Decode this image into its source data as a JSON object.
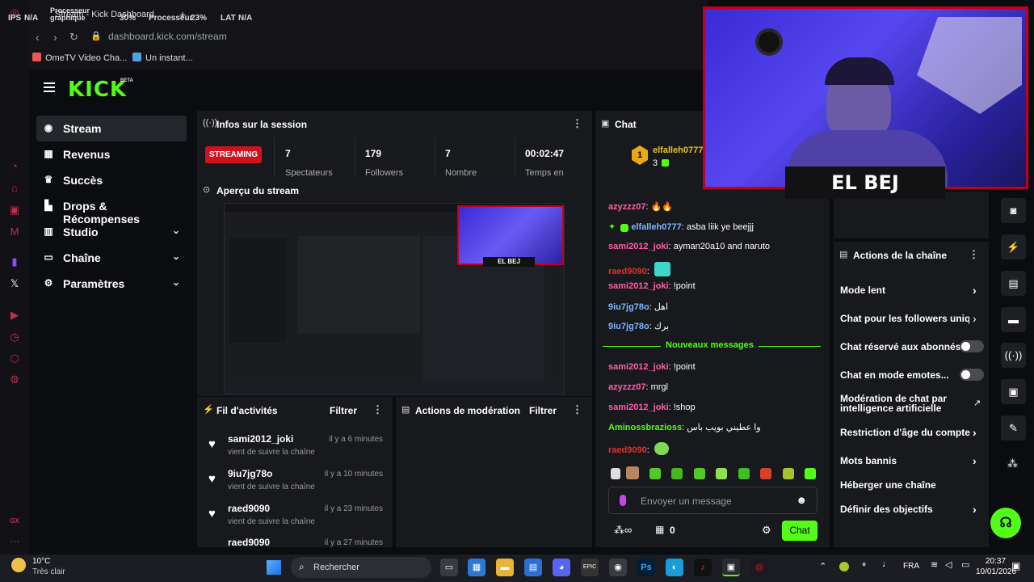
{
  "browser": {
    "tab_title": "Stream - Kick Dashboard",
    "perf": {
      "ips_label": "IPS",
      "ips_value": "N/A",
      "gpu_label": "Processeur graphique",
      "gpu_value": "30%",
      "cpu_label": "Processeur",
      "cpu_value": "23%",
      "lat_label": "LAT",
      "lat_value": "N/A"
    },
    "url": "dashboard.kick.com/stream",
    "bookmarks": [
      "OmeTV Video Cha...",
      "Un instant..."
    ],
    "opera_bottom_label": "GX"
  },
  "brand": {
    "logo": "KICK",
    "badge": "BETA",
    "accent": "#53fc18"
  },
  "sidebar": {
    "items": [
      {
        "label": "Stream",
        "icon": "broadcast-icon"
      },
      {
        "label": "Revenus",
        "icon": "chart-icon"
      },
      {
        "label": "Succès",
        "icon": "trophy-icon"
      },
      {
        "label": "Drops & Récompenses",
        "icon": "gift-icon"
      },
      {
        "label": "Studio",
        "icon": "studio-icon"
      },
      {
        "label": "Chaîne",
        "icon": "channel-icon"
      },
      {
        "label": "Paramètres",
        "icon": "gear-icon"
      }
    ]
  },
  "session": {
    "title": "Infos sur la session",
    "status": "STREAMING",
    "stats": [
      {
        "value": "7",
        "label": "Spectateurs"
      },
      {
        "value": "179",
        "label": "Followers"
      },
      {
        "value": "7",
        "label": "Nombre"
      },
      {
        "value": "00:02:47",
        "label": "Temps en"
      }
    ]
  },
  "preview": {
    "title": "Aperçu du stream",
    "overlay_name": "EL BEJ"
  },
  "activity": {
    "title": "Fil d'activités",
    "filter_label": "Filtrer",
    "items": [
      {
        "user": "sami2012_joki",
        "time": "il y a 6 minutes",
        "sub": "vient de suivre la chaîne"
      },
      {
        "user": "9iu7jg78o",
        "time": "il y a 10 minutes",
        "sub": "vient de suivre la chaîne"
      },
      {
        "user": "raed9090",
        "time": "il y a 23 minutes",
        "sub": "vient de suivre la chaîne"
      },
      {
        "user": "raed9090",
        "time": "il y a 27 minutes",
        "sub": ""
      }
    ]
  },
  "moderation": {
    "title": "Actions de modération",
    "filter_label": "Filtrer"
  },
  "chat": {
    "title": "Chat",
    "pinned_user": "elfalleh0777",
    "pinned_rank": "1",
    "pinned_count": "3",
    "messages": [
      {
        "user": "azyzzz07",
        "text": "🔥🔥",
        "color": "#ff5fa8"
      },
      {
        "user": "elfalleh0777",
        "text": "asba liik ye beejjj",
        "color": "#7eb6ff"
      },
      {
        "user": "sami2012_joki",
        "text": "ayman20a10 and naruto",
        "color": "#ff5fa8"
      },
      {
        "user": "raed9090",
        "text": "",
        "color": "#e0302e"
      },
      {
        "user": "sami2012_joki",
        "text": "!point",
        "color": "#ff5fa8"
      },
      {
        "user": "9iu7jg78o",
        "text": "اهل",
        "color": "#7eb6ff"
      },
      {
        "user": "9iu7jg78o",
        "text": "برك",
        "color": "#7eb6ff"
      }
    ],
    "new_messages_label": "Nouveaux messages",
    "new_messages": [
      {
        "user": "sami2012_joki",
        "text": "!point",
        "color": "#ff5fa8"
      },
      {
        "user": "azyzzz07",
        "text": "mrgl",
        "color": "#ff5fa8"
      },
      {
        "user": "sami2012_joki",
        "text": "!shop",
        "color": "#ff5fa8"
      },
      {
        "user": "Aminossbrazioss",
        "text": "وا عطيني بويب باس",
        "color": "#53fc18"
      },
      {
        "user": "raed9090",
        "text": "",
        "color": "#e0302e"
      }
    ],
    "input_placeholder": "Envoyer un message",
    "points_value": "0",
    "send_label": "Chat"
  },
  "channel_actions": {
    "title": "Actions de la chaîne",
    "items": [
      {
        "label": "Mode lent",
        "control": "arrow"
      },
      {
        "label": "Chat pour les followers uniq",
        "control": "arrow"
      },
      {
        "label": "Chat réservé aux abonnés",
        "control": "toggle"
      },
      {
        "label": "Chat en mode emotes...",
        "control": "toggle"
      },
      {
        "label": "Modération de chat par intelligence artificielle",
        "control": "external"
      },
      {
        "label": "Restriction d'âge du compte",
        "control": "arrow"
      },
      {
        "label": "Mots bannis",
        "control": "arrow"
      },
      {
        "label": "Héberger une chaîne",
        "control": "none"
      },
      {
        "label": "Définir des objectifs",
        "control": "arrow"
      }
    ]
  },
  "webcam": {
    "name": "EL BEJ"
  },
  "taskbar": {
    "weather_temp": "10°C",
    "weather_desc": "Très clair",
    "search_placeholder": "Rechercher",
    "lang": "FRA",
    "time": "20:37",
    "date": "10/01/2026"
  }
}
